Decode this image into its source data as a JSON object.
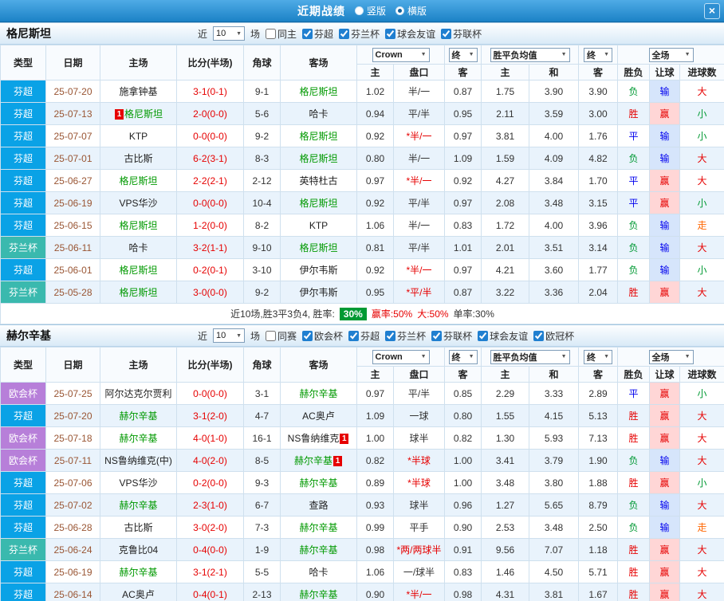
{
  "titlebar": {
    "title": "近期战绩",
    "view_options": [
      {
        "label": "竖版",
        "selected": false
      },
      {
        "label": "横版",
        "selected": true
      }
    ],
    "close_label": "×"
  },
  "colors": {
    "league": {
      "芬超": "#0aa2e6",
      "芬兰杯": "#3ab9ae",
      "欧会杯": "#b77fd9"
    },
    "result": {
      "胜": "#e60000",
      "平": "#0000ee",
      "负": "#009933"
    },
    "handicap_result": {
      "赢": {
        "fg": "#e60000",
        "bg": "#ffd6d6"
      },
      "输": {
        "fg": "#0000ee",
        "bg": "#d6e5fb"
      }
    },
    "goals": {
      "大": "#e60000",
      "小": "#009933",
      "走": "#ff6600"
    },
    "focus_team": "#009900",
    "score": "#e60000",
    "date": "#995533",
    "handicap_star": "#e60000",
    "red_card": "#e60000"
  },
  "sections": [
    {
      "team": "格尼斯坦",
      "near_label": "近",
      "near_value": "10",
      "games_label": "场",
      "filters": [
        {
          "label": "同主",
          "checked": false
        },
        {
          "label": "芬超",
          "checked": true
        },
        {
          "label": "芬兰杯",
          "checked": true
        },
        {
          "label": "球会友谊",
          "checked": true
        },
        {
          "label": "芬联杯",
          "checked": true
        }
      ],
      "header": {
        "type": "类型",
        "date": "日期",
        "home": "主场",
        "score": "比分(半场)",
        "corner": "角球",
        "away": "客场",
        "bookmaker": "Crown",
        "final1": "终",
        "avg_label": "胜平负均值",
        "final2": "终",
        "scope": "全场",
        "h": "主",
        "hcap": "盘口",
        "a": "客",
        "ah": "主",
        "ad": "和",
        "aa": "客",
        "res": "胜负",
        "hres": "让球",
        "goals": "进球数"
      },
      "rows": [
        {
          "league": "芬超",
          "date": "25-07-20",
          "home": "施拿钟基",
          "home_focus": false,
          "score": "3-1(0-1)",
          "corner": "9-1",
          "away": "格尼斯坦",
          "away_focus": true,
          "odds_home": "1.02",
          "handicap": "半/一",
          "odds_away": "0.87",
          "avg_home": "1.75",
          "avg_draw": "3.90",
          "avg_away": "3.90",
          "result": "负",
          "handicap_result": "输",
          "goals": "大"
        },
        {
          "league": "芬超",
          "date": "25-07-13",
          "home": "格尼斯坦",
          "home_focus": true,
          "home_rc": "1",
          "home_rc_pos": "before",
          "score": "2-0(0-0)",
          "corner": "5-6",
          "away": "哈卡",
          "away_focus": false,
          "odds_home": "0.94",
          "handicap": "平/半",
          "odds_away": "0.95",
          "avg_home": "2.11",
          "avg_draw": "3.59",
          "avg_away": "3.00",
          "result": "胜",
          "handicap_result": "赢",
          "goals": "小"
        },
        {
          "league": "芬超",
          "date": "25-07-07",
          "home": "KTP",
          "home_focus": false,
          "score": "0-0(0-0)",
          "corner": "9-2",
          "away": "格尼斯坦",
          "away_focus": true,
          "odds_home": "0.92",
          "handicap": "*半/一",
          "odds_away": "0.97",
          "avg_home": "3.81",
          "avg_draw": "4.00",
          "avg_away": "1.76",
          "result": "平",
          "handicap_result": "输",
          "goals": "小"
        },
        {
          "league": "芬超",
          "date": "25-07-01",
          "home": "古比斯",
          "home_focus": false,
          "score": "6-2(3-1)",
          "corner": "8-3",
          "away": "格尼斯坦",
          "away_focus": true,
          "odds_home": "0.80",
          "handicap": "半/一",
          "odds_away": "1.09",
          "avg_home": "1.59",
          "avg_draw": "4.09",
          "avg_away": "4.82",
          "result": "负",
          "handicap_result": "输",
          "goals": "大"
        },
        {
          "league": "芬超",
          "date": "25-06-27",
          "home": "格尼斯坦",
          "home_focus": true,
          "score": "2-2(2-1)",
          "corner": "2-12",
          "away": "英特杜古",
          "away_focus": false,
          "odds_home": "0.97",
          "handicap": "*半/一",
          "odds_away": "0.92",
          "avg_home": "4.27",
          "avg_draw": "3.84",
          "avg_away": "1.70",
          "result": "平",
          "handicap_result": "赢",
          "goals": "大"
        },
        {
          "league": "芬超",
          "date": "25-06-19",
          "home": "VPS华沙",
          "home_focus": false,
          "score": "0-0(0-0)",
          "corner": "10-4",
          "away": "格尼斯坦",
          "away_focus": true,
          "odds_home": "0.92",
          "handicap": "平/半",
          "odds_away": "0.97",
          "avg_home": "2.08",
          "avg_draw": "3.48",
          "avg_away": "3.15",
          "result": "平",
          "handicap_result": "赢",
          "goals": "小"
        },
        {
          "league": "芬超",
          "date": "25-06-15",
          "home": "格尼斯坦",
          "home_focus": true,
          "score": "1-2(0-0)",
          "corner": "8-2",
          "away": "KTP",
          "away_focus": false,
          "odds_home": "1.06",
          "handicap": "半/一",
          "odds_away": "0.83",
          "avg_home": "1.72",
          "avg_draw": "4.00",
          "avg_away": "3.96",
          "result": "负",
          "handicap_result": "输",
          "goals": "走"
        },
        {
          "league": "芬兰杯",
          "date": "25-06-11",
          "home": "哈卡",
          "home_focus": false,
          "score": "3-2(1-1)",
          "corner": "9-10",
          "away": "格尼斯坦",
          "away_focus": true,
          "odds_home": "0.81",
          "handicap": "平/半",
          "odds_away": "1.01",
          "avg_home": "2.01",
          "avg_draw": "3.51",
          "avg_away": "3.14",
          "result": "负",
          "handicap_result": "输",
          "goals": "大"
        },
        {
          "league": "芬超",
          "date": "25-06-01",
          "home": "格尼斯坦",
          "home_focus": true,
          "score": "0-2(0-1)",
          "corner": "3-10",
          "away": "伊尔韦斯",
          "away_focus": false,
          "odds_home": "0.92",
          "handicap": "*半/一",
          "odds_away": "0.97",
          "avg_home": "4.21",
          "avg_draw": "3.60",
          "avg_away": "1.77",
          "result": "负",
          "handicap_result": "输",
          "goals": "小"
        },
        {
          "league": "芬兰杯",
          "date": "25-05-28",
          "home": "格尼斯坦",
          "home_focus": true,
          "score": "3-0(0-0)",
          "corner": "9-2",
          "away": "伊尔韦斯",
          "away_focus": false,
          "odds_home": "0.95",
          "handicap": "*平/半",
          "odds_away": "0.87",
          "avg_home": "3.22",
          "avg_draw": "3.36",
          "avg_away": "2.04",
          "result": "胜",
          "handicap_result": "赢",
          "goals": "大"
        }
      ],
      "summary_parts": [
        {
          "text": "近10场,胜3平3负4, 胜率:",
          "color": "#333333"
        },
        {
          "text": "30%",
          "color": "#ffffff",
          "bg": "#009933"
        },
        {
          "text": "赢率:50%",
          "color": "#e60000"
        },
        {
          "text": "大:50%",
          "color": "#e60000"
        },
        {
          "text": "单率:30%",
          "color": "#333333"
        }
      ]
    },
    {
      "team": "赫尔辛基",
      "near_label": "近",
      "near_value": "10",
      "games_label": "场",
      "filters": [
        {
          "label": "同赛",
          "checked": false
        },
        {
          "label": "欧会杯",
          "checked": true
        },
        {
          "label": "芬超",
          "checked": true
        },
        {
          "label": "芬兰杯",
          "checked": true
        },
        {
          "label": "芬联杯",
          "checked": true
        },
        {
          "label": "球会友谊",
          "checked": true
        },
        {
          "label": "欧冠杯",
          "checked": true
        }
      ],
      "header": {
        "type": "类型",
        "date": "日期",
        "home": "主场",
        "score": "比分(半场)",
        "corner": "角球",
        "away": "客场",
        "bookmaker": "Crown",
        "final1": "终",
        "avg_label": "胜平负均值",
        "final2": "终",
        "scope": "全场",
        "h": "主",
        "hcap": "盘口",
        "a": "客",
        "ah": "主",
        "ad": "和",
        "aa": "客",
        "res": "胜负",
        "hres": "让球",
        "goals": "进球数"
      },
      "rows": [
        {
          "league": "欧会杯",
          "date": "25-07-25",
          "home": "阿尔达克尔贾利",
          "home_focus": false,
          "score": "0-0(0-0)",
          "corner": "3-1",
          "away": "赫尔辛基",
          "away_focus": true,
          "odds_home": "0.97",
          "handicap": "平/半",
          "odds_away": "0.85",
          "avg_home": "2.29",
          "avg_draw": "3.33",
          "avg_away": "2.89",
          "result": "平",
          "handicap_result": "赢",
          "goals": "小"
        },
        {
          "league": "芬超",
          "date": "25-07-20",
          "home": "赫尔辛基",
          "home_focus": true,
          "score": "3-1(2-0)",
          "corner": "4-7",
          "away": "AC奥卢",
          "away_focus": false,
          "odds_home": "1.09",
          "handicap": "一球",
          "odds_away": "0.80",
          "avg_home": "1.55",
          "avg_draw": "4.15",
          "avg_away": "5.13",
          "result": "胜",
          "handicap_result": "赢",
          "goals": "大"
        },
        {
          "league": "欧会杯",
          "date": "25-07-18",
          "home": "赫尔辛基",
          "home_focus": true,
          "score": "4-0(1-0)",
          "corner": "16-1",
          "away": "NS鲁纳维克",
          "away_focus": false,
          "away_rc": "1",
          "away_rc_pos": "after",
          "odds_home": "1.00",
          "handicap": "球半",
          "odds_away": "0.82",
          "avg_home": "1.30",
          "avg_draw": "5.93",
          "avg_away": "7.13",
          "result": "胜",
          "handicap_result": "赢",
          "goals": "大"
        },
        {
          "league": "欧会杯",
          "date": "25-07-11",
          "home": "NS鲁纳维克(中)",
          "home_focus": false,
          "score": "4-0(2-0)",
          "corner": "8-5",
          "away": "赫尔辛基",
          "away_focus": true,
          "away_rc": "1",
          "away_rc_pos": "after",
          "odds_home": "0.82",
          "handicap": "*半球",
          "odds_away": "1.00",
          "avg_home": "3.41",
          "avg_draw": "3.79",
          "avg_away": "1.90",
          "result": "负",
          "handicap_result": "输",
          "goals": "大"
        },
        {
          "league": "芬超",
          "date": "25-07-06",
          "home": "VPS华沙",
          "home_focus": false,
          "score": "0-2(0-0)",
          "corner": "9-3",
          "away": "赫尔辛基",
          "away_focus": true,
          "odds_home": "0.89",
          "handicap": "*半球",
          "odds_away": "1.00",
          "avg_home": "3.48",
          "avg_draw": "3.80",
          "avg_away": "1.88",
          "result": "胜",
          "handicap_result": "赢",
          "goals": "小"
        },
        {
          "league": "芬超",
          "date": "25-07-02",
          "home": "赫尔辛基",
          "home_focus": true,
          "score": "2-3(1-0)",
          "corner": "6-7",
          "away": "查路",
          "away_focus": false,
          "odds_home": "0.93",
          "handicap": "球半",
          "odds_away": "0.96",
          "avg_home": "1.27",
          "avg_draw": "5.65",
          "avg_away": "8.79",
          "result": "负",
          "handicap_result": "输",
          "goals": "大"
        },
        {
          "league": "芬超",
          "date": "25-06-28",
          "home": "古比斯",
          "home_focus": false,
          "score": "3-0(2-0)",
          "corner": "7-3",
          "away": "赫尔辛基",
          "away_focus": true,
          "odds_home": "0.99",
          "handicap": "平手",
          "odds_away": "0.90",
          "avg_home": "2.53",
          "avg_draw": "3.48",
          "avg_away": "2.50",
          "result": "负",
          "handicap_result": "输",
          "goals": "走"
        },
        {
          "league": "芬兰杯",
          "date": "25-06-24",
          "home": "克鲁比04",
          "home_focus": false,
          "score": "0-4(0-0)",
          "corner": "1-9",
          "away": "赫尔辛基",
          "away_focus": true,
          "odds_home": "0.98",
          "handicap": "*两/两球半",
          "odds_away": "0.91",
          "avg_home": "9.56",
          "avg_draw": "7.07",
          "avg_away": "1.18",
          "result": "胜",
          "handicap_result": "赢",
          "goals": "大"
        },
        {
          "league": "芬超",
          "date": "25-06-19",
          "home": "赫尔辛基",
          "home_focus": true,
          "score": "3-1(2-1)",
          "corner": "5-5",
          "away": "哈卡",
          "away_focus": false,
          "odds_home": "1.06",
          "handicap": "一/球半",
          "odds_away": "0.83",
          "avg_home": "1.46",
          "avg_draw": "4.50",
          "avg_away": "5.71",
          "result": "胜",
          "handicap_result": "赢",
          "goals": "大"
        },
        {
          "league": "芬超",
          "date": "25-06-14",
          "home": "AC奥卢",
          "home_focus": false,
          "score": "0-4(0-1)",
          "corner": "2-13",
          "away": "赫尔辛基",
          "away_focus": true,
          "odds_home": "0.90",
          "handicap": "*半/一",
          "odds_away": "0.98",
          "avg_home": "4.31",
          "avg_draw": "3.81",
          "avg_away": "1.67",
          "result": "胜",
          "handicap_result": "赢",
          "goals": "大"
        }
      ]
    }
  ]
}
